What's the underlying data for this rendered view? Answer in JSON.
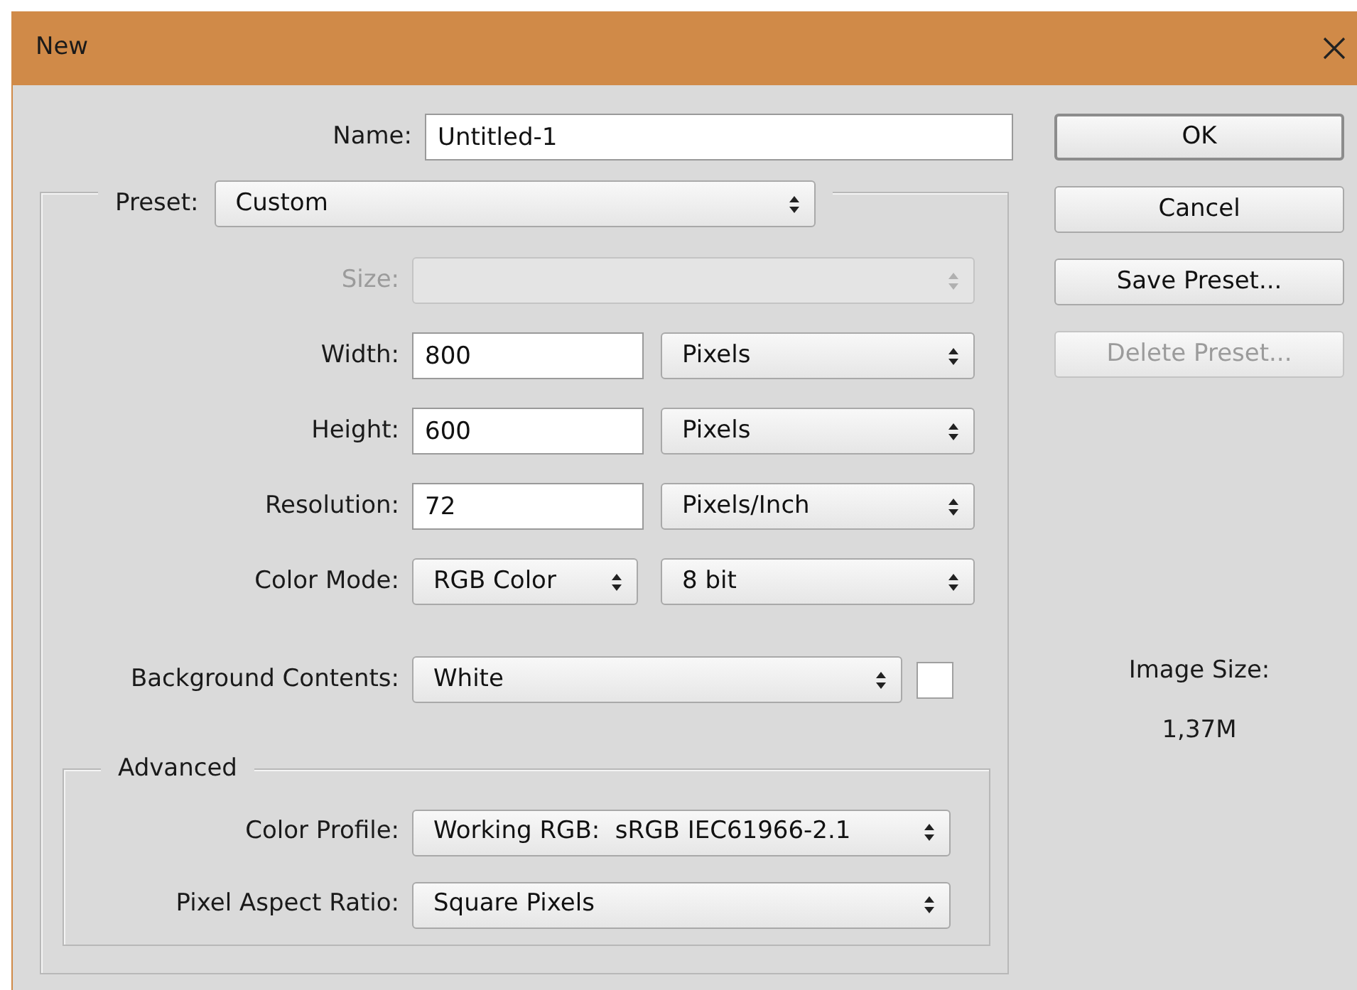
{
  "window": {
    "title": "New"
  },
  "name": {
    "label": "Name:",
    "value": "Untitled-1"
  },
  "preset": {
    "label": "Preset:",
    "value": "Custom"
  },
  "fields": [
    {
      "kind": "select",
      "label": "Size:",
      "disabled": true
    },
    {
      "kind": "number-unit",
      "label": "Width:",
      "value": "800",
      "unit": "Pixels",
      "disabled": false
    },
    {
      "kind": "number-unit",
      "label": "Height:",
      "value": "600",
      "unit": "Pixels",
      "disabled": false
    },
    {
      "kind": "number-unit",
      "label": "Resolution:",
      "value": "72",
      "unit": "Pixels/Inch",
      "disabled": false
    },
    {
      "kind": "select-pair",
      "label": "Color Mode:",
      "value": "RGB Color",
      "unit": "8 bit",
      "disabled": false
    },
    {
      "kind": "select-swatch",
      "label": "Background Contents:",
      "value": "White",
      "color": "#ffffff",
      "disabled": false
    }
  ],
  "advanced": {
    "title": "Advanced",
    "fields": [
      {
        "label": "Color Profile:",
        "value": "Working RGB:  sRGB IEC61966-2.1"
      },
      {
        "label": "Pixel Aspect Ratio:",
        "value": "Square Pixels"
      }
    ]
  },
  "buttons": [
    {
      "label": "OK",
      "default": true,
      "disabled": false
    },
    {
      "label": "Cancel",
      "default": false,
      "disabled": false
    },
    {
      "label": "Save Preset...",
      "default": false,
      "disabled": false
    },
    {
      "label": "Delete Preset...",
      "default": false,
      "disabled": true
    }
  ],
  "image_size": {
    "label": "Image Size:",
    "value": "1,37M"
  }
}
